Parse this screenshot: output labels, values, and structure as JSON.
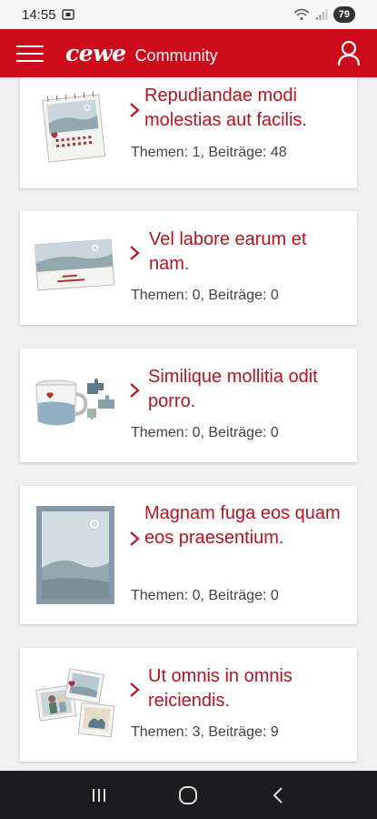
{
  "status": {
    "time": "14:55",
    "battery": "79"
  },
  "app": {
    "brand": "cewe",
    "section": "Community"
  },
  "forums": [
    {
      "title": "Repudiandae modi molestias aut facilis.",
      "meta": "Themen: 1, Beiträge: 48",
      "icon": "calendar-illustration"
    },
    {
      "title": "Vel labore earum et nam.",
      "meta": "Themen: 0, Beiträge: 0",
      "icon": "card-illustration"
    },
    {
      "title": "Similique mollitia odit porro.",
      "meta": "Themen: 0, Beiträge: 0",
      "icon": "mug-puzzle-illustration"
    },
    {
      "title": "Magnam fuga eos quam eos praesentium.",
      "meta": "Themen: 0, Beiträge: 0",
      "icon": "poster-illustration"
    },
    {
      "title": "Ut omnis in omnis reiciendis.",
      "meta": "Themen: 3, Beiträge: 9",
      "icon": "photos-illustration"
    }
  ],
  "colors": {
    "brand": "#cc0a1b",
    "title": "#b5141f"
  }
}
